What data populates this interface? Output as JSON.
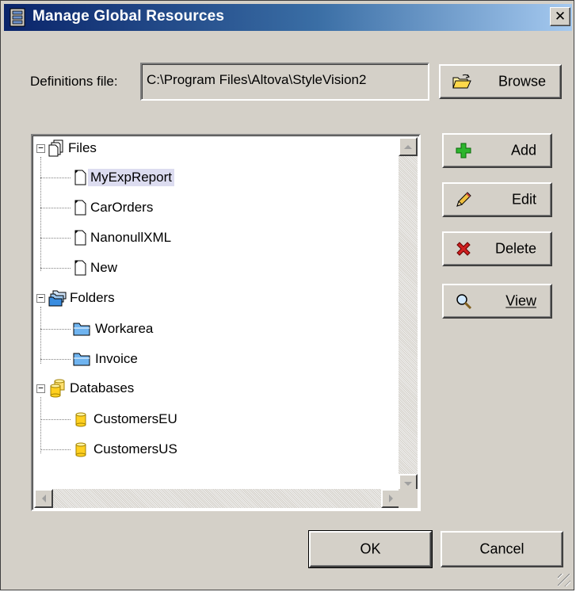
{
  "window": {
    "title": "Manage Global Resources",
    "close_label": "✕"
  },
  "definitions": {
    "label": "Definitions file:",
    "path": "C:\\Program Files\\Altova\\StyleVision2",
    "browse_label": "Browse"
  },
  "tree": {
    "groups": [
      {
        "label": "Files",
        "icon": "file-group-icon",
        "items": [
          "MyExpReport",
          "CarOrders",
          "NanonullXML",
          "New"
        ],
        "item_icon": "file-icon"
      },
      {
        "label": "Folders",
        "icon": "folder-group-icon",
        "items": [
          "Workarea",
          "Invoice"
        ],
        "item_icon": "folder-icon"
      },
      {
        "label": "Databases",
        "icon": "database-group-icon",
        "items": [
          "CustomersEU",
          "CustomersUS"
        ],
        "item_icon": "database-icon"
      }
    ],
    "selected": "MyExpReport"
  },
  "actions": {
    "add": "Add",
    "edit": "Edit",
    "delete": "Delete",
    "view": "View"
  },
  "footer": {
    "ok": "OK",
    "cancel": "Cancel"
  },
  "colors": {
    "face": "#d4d0c8",
    "title_start": "#0a246a",
    "title_end": "#a6caf0",
    "selection": "#dcdcf0"
  }
}
